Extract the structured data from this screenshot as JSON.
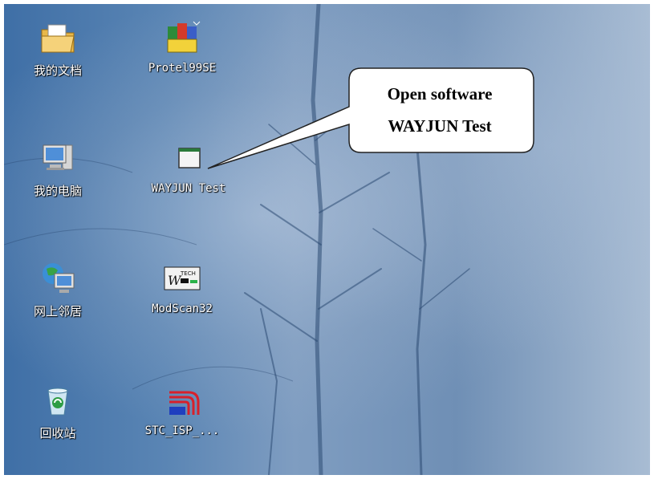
{
  "desktop": {
    "icons": [
      {
        "name": "my-documents",
        "label": "我的文档",
        "icon": "folder-documents-icon"
      },
      {
        "name": "protel99se",
        "label": "Protel99SE",
        "icon": "protel-app-icon"
      },
      {
        "name": "my-computer",
        "label": "我的电脑",
        "icon": "computer-icon"
      },
      {
        "name": "wayjun-test",
        "label": "WAYJUN Test",
        "icon": "window-app-icon"
      },
      {
        "name": "network-places",
        "label": "网上邻居",
        "icon": "network-globe-icon"
      },
      {
        "name": "modscan32",
        "label": "ModScan32",
        "icon": "wintech-icon"
      },
      {
        "name": "recycle-bin",
        "label": "回收站",
        "icon": "recycle-bin-icon"
      },
      {
        "name": "stc-isp",
        "label": "STC_ISP_...",
        "icon": "stc-isp-icon"
      }
    ]
  },
  "callout": {
    "line1": "Open software",
    "line2": "WAYJUN Test"
  },
  "colors": {
    "sky_dark": "#3f6fa6",
    "sky_light": "#a8bcd3",
    "label_text": "#ffffff"
  }
}
